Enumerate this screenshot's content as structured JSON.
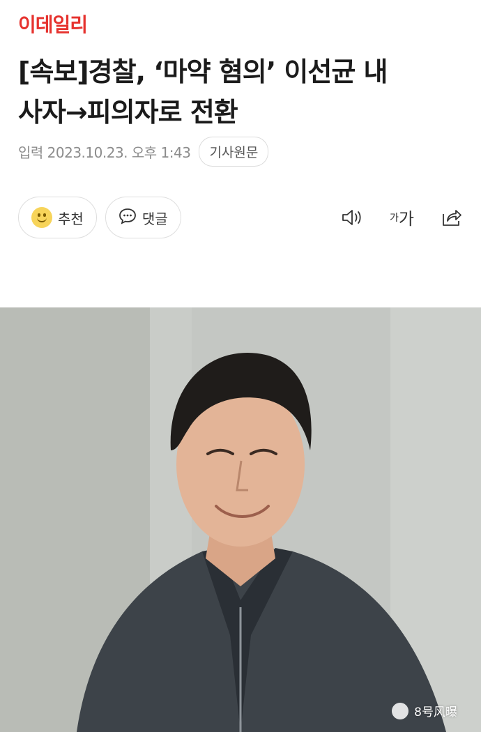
{
  "brand": {
    "name": "이데일리",
    "color": "#e6322e"
  },
  "article": {
    "headline_line1": "[속보]경찰, ‘마약 혐의’ 이선균 내",
    "headline_line2": "사자→피의자로 전환",
    "date": "입력 2023.10.23. 오후 1:43",
    "source_button": "기사원문"
  },
  "actions": {
    "recommend_label": "추천",
    "comment_label": "댓글"
  },
  "tools": {
    "font_small": "가",
    "font_large": "가",
    "icons": [
      "speaker-icon",
      "font-size-icon",
      "share-icon"
    ]
  },
  "photo": {
    "description_icon": "portrait-photo",
    "watermark": "8号风曝"
  }
}
